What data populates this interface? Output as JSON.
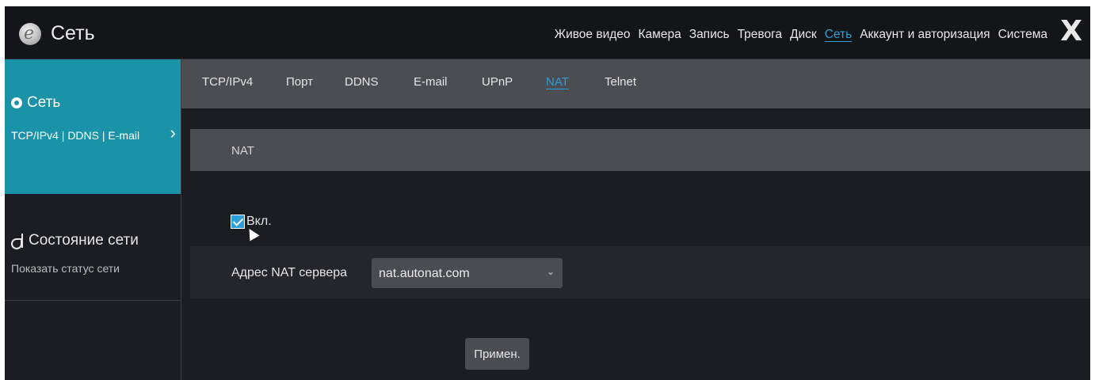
{
  "app": {
    "title": "Сеть"
  },
  "top_nav": {
    "items": [
      "Живое видео",
      "Камера",
      "Запись",
      "Тревога",
      "Диск",
      "Сеть",
      "Аккаунт и авторизация",
      "Система"
    ],
    "active": "Сеть",
    "close_label": "X"
  },
  "sidebar": {
    "network": {
      "title": "Сеть",
      "links": "TCP/IPv4 | DDNS | E-mail",
      "chevron": "›"
    },
    "network_status": {
      "title": "Состояние сети",
      "subtitle": "Показать статус сети"
    }
  },
  "sub_tabs": {
    "items": [
      "TCP/IPv4",
      "Порт",
      "DDNS",
      "E-mail",
      "UPnP",
      "NAT",
      "Telnet"
    ],
    "active": "NAT"
  },
  "section": {
    "title": "NAT"
  },
  "form": {
    "enable_label": "Вкл.",
    "enable_checked": true,
    "server_label": "Адрес NAT сервера",
    "server_value": "nat.autonat.com",
    "apply_label": "Примен."
  },
  "colors": {
    "accent": "#2e9fd8",
    "sidebar_active": "#1a93a8",
    "background": "#1c1d22",
    "panel": "#4b4d52"
  }
}
